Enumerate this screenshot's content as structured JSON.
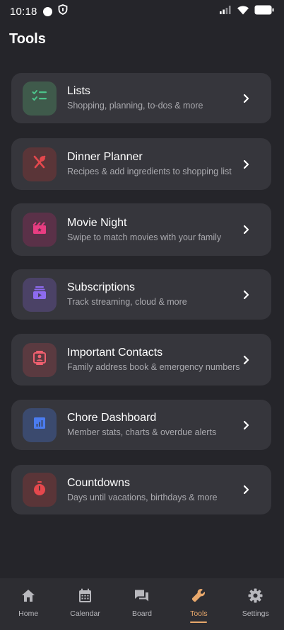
{
  "status": {
    "time": "10:18"
  },
  "page": {
    "title": "Tools"
  },
  "tools": [
    {
      "title": "Lists",
      "subtitle": "Shopping, planning, to-dos & more",
      "icon": "checklist-icon",
      "color": "#4cc38a"
    },
    {
      "title": "Dinner Planner",
      "subtitle": "Recipes & add ingredients to shopping list",
      "icon": "utensils-icon",
      "color": "#e5484d"
    },
    {
      "title": "Movie Night",
      "subtitle": "Swipe to match movies with your family",
      "icon": "movie-icon",
      "color": "#e93d82"
    },
    {
      "title": "Subscriptions",
      "subtitle": "Track streaming, cloud & more",
      "icon": "subscriptions-icon",
      "color": "#8e6bf0"
    },
    {
      "title": "Important Contacts",
      "subtitle": "Family address book & emergency numbers",
      "icon": "contact-card-icon",
      "color": "#f0606f"
    },
    {
      "title": "Chore Dashboard",
      "subtitle": "Member stats, charts & overdue alerts",
      "icon": "chart-icon",
      "color": "#4b7cf0"
    },
    {
      "title": "Countdowns",
      "subtitle": "Days until vacations, birthdays & more",
      "icon": "timer-icon",
      "color": "#e5484d"
    }
  ],
  "nav": {
    "items": [
      {
        "label": "Home",
        "icon": "home-icon"
      },
      {
        "label": "Calendar",
        "icon": "calendar-icon"
      },
      {
        "label": "Board",
        "icon": "chat-icon"
      },
      {
        "label": "Tools",
        "icon": "wrench-icon"
      },
      {
        "label": "Settings",
        "icon": "gear-icon"
      }
    ],
    "active": "Tools",
    "active_color": "#e8a86c"
  }
}
